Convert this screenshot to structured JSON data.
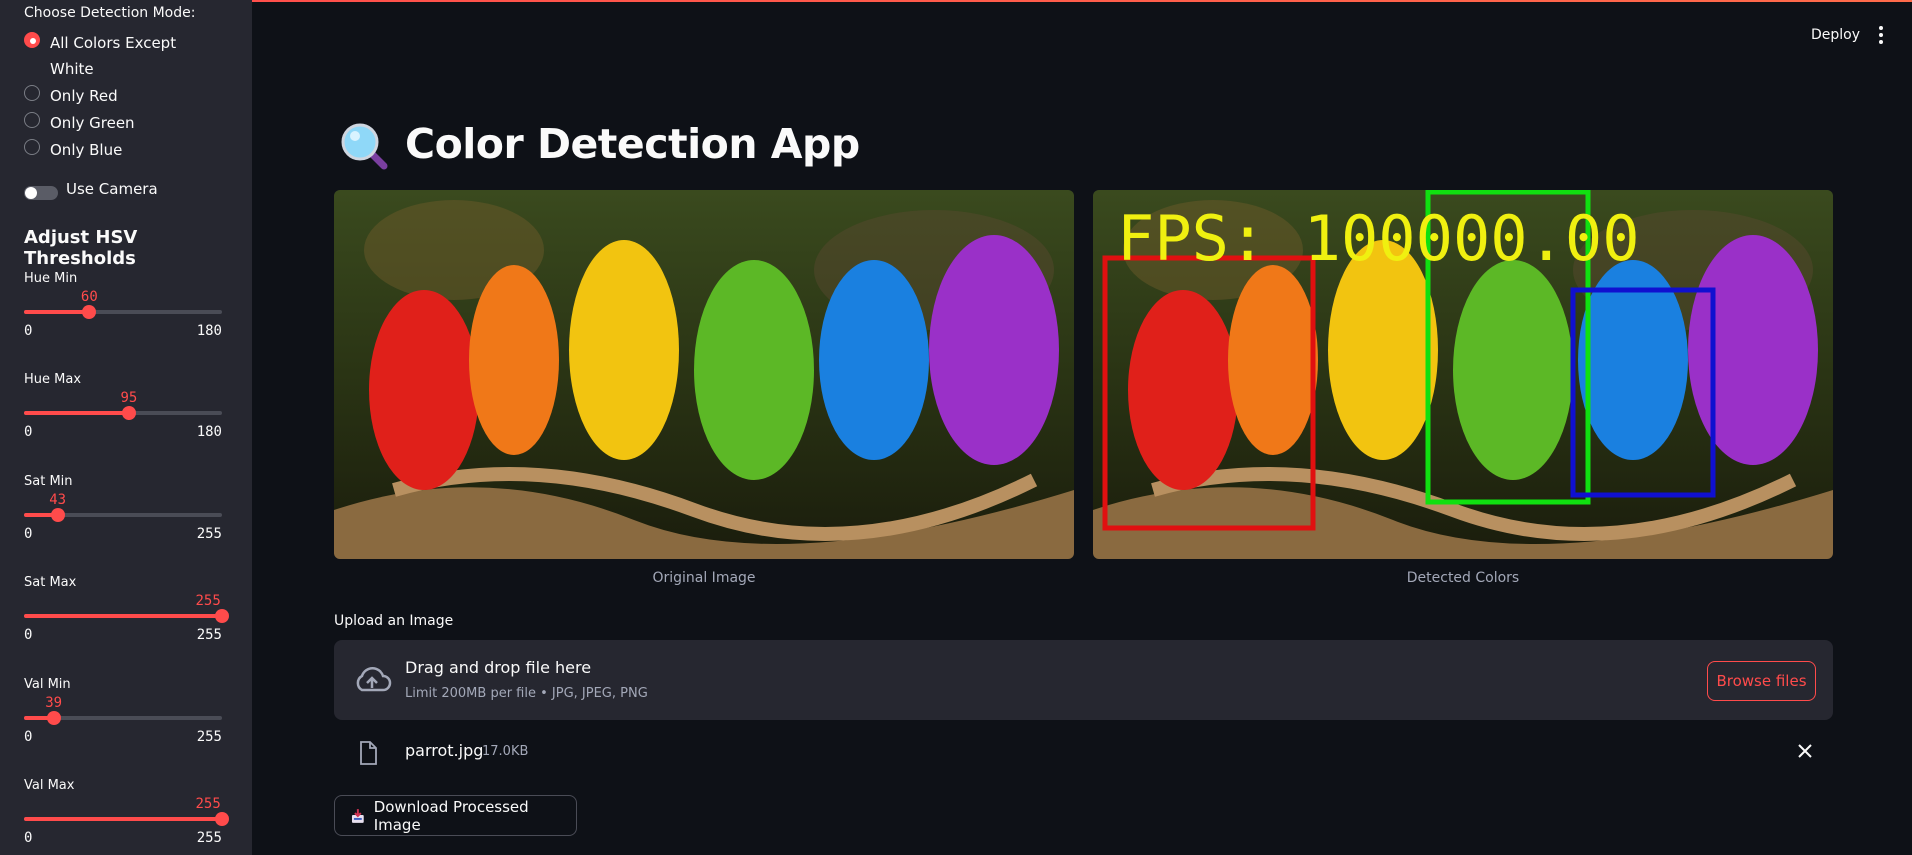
{
  "sidebar": {
    "mode_label": "Choose Detection Mode:",
    "modes": [
      {
        "label": "All Colors Except White",
        "selected": true
      },
      {
        "label": "Only Red",
        "selected": false
      },
      {
        "label": "Only Green",
        "selected": false
      },
      {
        "label": "Only Blue",
        "selected": false
      }
    ],
    "camera_label": "Use Camera",
    "camera_on": false,
    "hsv_heading": "Adjust HSV Thresholds",
    "sliders": [
      {
        "label": "Hue Min",
        "value": "60",
        "min": "0",
        "max": "180"
      },
      {
        "label": "Hue Max",
        "value": "95",
        "min": "0",
        "max": "180"
      },
      {
        "label": "Sat Min",
        "value": "43",
        "min": "0",
        "max": "255"
      },
      {
        "label": "Sat Max",
        "value": "255",
        "min": "0",
        "max": "255"
      },
      {
        "label": "Val Min",
        "value": "39",
        "min": "0",
        "max": "255"
      },
      {
        "label": "Val Max",
        "value": "255",
        "min": "0",
        "max": "255"
      }
    ]
  },
  "header": {
    "deploy_label": "Deploy"
  },
  "main": {
    "title": "Color Detection App",
    "original_caption": "Original Image",
    "detected_caption": "Detected Colors",
    "fps_text": "FPS: 100000.00",
    "upload_label": "Upload an Image",
    "dropzone_title": "Drag and drop file here",
    "dropzone_sub": "Limit 200MB per file • JPG, JPEG, PNG",
    "browse_label": "Browse files",
    "file_name": "parrot.jpg",
    "file_size": "17.0KB",
    "download_label": "Download Processed Image"
  },
  "colors": {
    "accent": "#ff4b4b",
    "sidebar_bg": "#262730",
    "main_bg": "#0e1117"
  }
}
